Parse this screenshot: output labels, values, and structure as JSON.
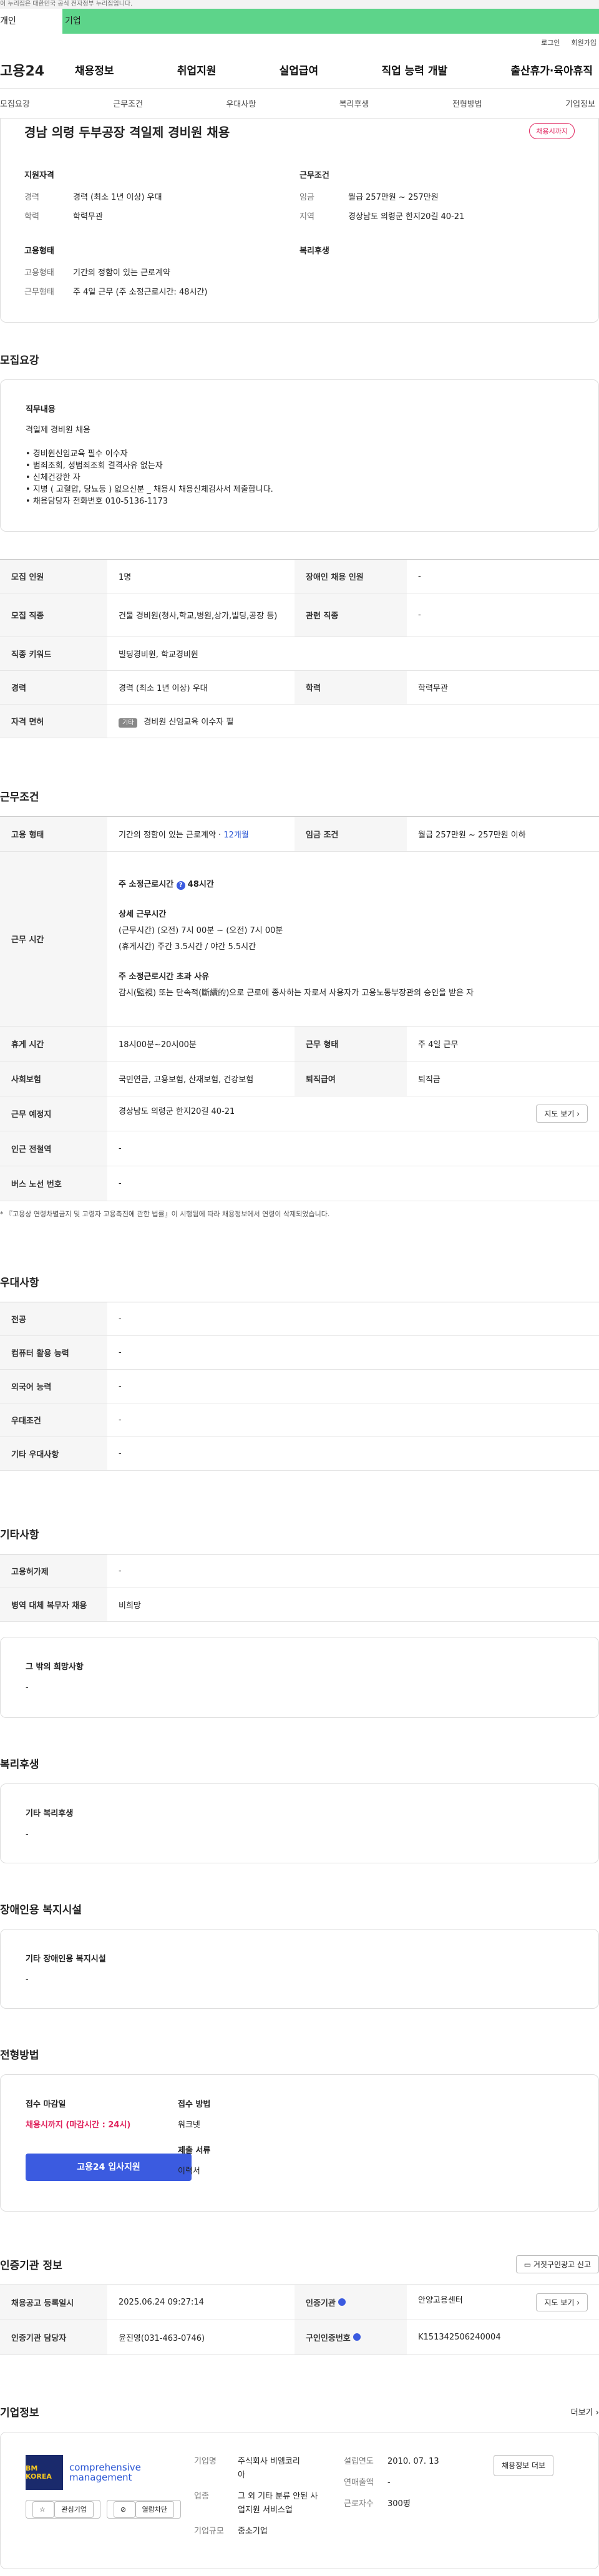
{
  "gov_banner": "이 누리집은 대한민국 공식 전자정부 누리집입니다.",
  "top_tabs": [
    "개인",
    "기업"
  ],
  "util_links": [
    "로그인",
    "회원가입"
  ],
  "logo": "고용24",
  "gnb": [
    "채용정보",
    "취업지원",
    "실업급여",
    "직업 능력 개발",
    "출산휴가·육아휴직"
  ],
  "anchor_nav": [
    "모집요강",
    "근무조건",
    "우대사항",
    "복리후생",
    "전형방법",
    "기업정보"
  ],
  "job": {
    "title": "경남 의령 두부공장 격일제 경비원 채용",
    "status_badge": "채용시까지",
    "qual_heading": "지원자격",
    "career_label": "경력",
    "career_value": "경력 (최소 1년 이상) 우대",
    "edu_label": "학력",
    "edu_value": "학력무관",
    "work_heading": "근무조건",
    "wage_label": "임금",
    "wage_value": "월급 257만원 ~ 257만원",
    "region_label": "지역",
    "region_value": "경상남도 의령군 한지20길 40-21",
    "emp_heading": "고용형태",
    "emp_label": "고용형태",
    "emp_value": "기간의 정함이 있는 근로계약",
    "worktype_label": "근무형태",
    "worktype_value": "주 4일 근무 (주 소정근로시간: 48시간)",
    "welfare_heading": "복리후생"
  },
  "recruit": {
    "heading": "모집요강",
    "duty_heading": "직무내용",
    "duty_lines": [
      "격일제 경비원 채용",
      "",
      "• 경비원신임교육 필수 이수자",
      "• 범죄조회, 성범죄조회 결격사유 없는자",
      "• 신체건강한 자",
      "• 지병 ( 고혈압, 당뇨등 ) 없으신분 _ 채용시 채용신체검사서 제출합니다.",
      "• 채용담당자 전화번호 010-5136-1173"
    ],
    "rows": {
      "count_label": "모집 인원",
      "count_value": "1명",
      "disabled_label": "장애인 채용 인원",
      "disabled_value": "-",
      "job_label": "모집 직종",
      "job_value": "건물 경비원(청사,학교,병원,상가,빌딩,공장 등)",
      "related_label": "관련 직종",
      "related_value": "-",
      "keyword_label": "직종 키워드",
      "keyword_value": "빌딩경비원, 학교경비원",
      "career_label": "경력",
      "career_value": "경력 (최소 1년 이상) 우대",
      "edu_label": "학력",
      "edu_value": "학력무관",
      "license_label": "자격 면허",
      "license_badge": "기타",
      "license_value": "경비원 신임교육 이수자 필"
    }
  },
  "work": {
    "heading": "근무조건",
    "emp_label": "고용 형태",
    "emp_value": "기간의 정함이 있는 근로계약 · ",
    "emp_period": "12개월",
    "wage_label": "임금 조건",
    "wage_value": "월급 257만원 ~ 257만원 이하",
    "hours_label": "근무 시간",
    "hours_week": "주 소정근로시간 ",
    "hours_week_value": "48시간",
    "hours_detail_title": "상세 근무시간",
    "hours_detail_1": "(근무시간) (오전) 7시 00분 ~ (오전) 7시 00분",
    "hours_detail_2": "(휴게시간) 주간 3.5시간 / 야간 5.5시간",
    "hours_over_title": "주 소정근로시간 초과 사유",
    "hours_over_text": "감시(監視) 또는 단속적(斷續的)으로 근로에 종사하는 자로서 사용자가 고용노동부장관의 승인을 받은 자",
    "break_label": "휴게 시간",
    "break_value": "18시00분~20시00분",
    "worktype_label": "근무 형태",
    "worktype_value": "주 4일 근무",
    "insurance_label": "사회보험",
    "insurance_value": "국민연금, 고용보험, 산재보험, 건강보험",
    "severance_label": "퇴직급여",
    "severance_value": "퇴직금",
    "location_label": "근무 예정지",
    "location_value": "경상남도 의령군 한지20길 40-21",
    "map_button": "지도 보기",
    "station_label": "인근 전철역",
    "station_value": "-",
    "bus_label": "버스 노선 번호",
    "bus_value": "-",
    "note": "* 『고용상 연령차별금지 및 고령자 고용촉진에 관한 법률』이 시행됨에 따라 채용정보에서 연령이 삭제되었습니다."
  },
  "prefer": {
    "heading": "우대사항",
    "rows": [
      {
        "label": "전공",
        "value": "-"
      },
      {
        "label": "컴퓨터 활용 능력",
        "value": "-"
      },
      {
        "label": "외국어 능력",
        "value": "-"
      },
      {
        "label": "우대조건",
        "value": "-"
      },
      {
        "label": "기타 우대사항",
        "value": "-"
      }
    ]
  },
  "etc": {
    "heading": "기타사항",
    "rows": [
      {
        "label": "고용허가제",
        "value": "-"
      },
      {
        "label": "병역 대체 복무자 채용",
        "value": "비희망"
      }
    ],
    "other_title": "그 밖의 희망사항",
    "other_value": "-"
  },
  "welfare": {
    "heading": "복리후생",
    "title": "기타 복리후생",
    "value": "-"
  },
  "disability": {
    "heading": "장애인용 복지시설",
    "title": "기타 장애인용 복지시설",
    "value": "-"
  },
  "process": {
    "heading": "전형방법",
    "deadline_label": "접수 마감일",
    "deadline_value": "채용시까지 (마감시간 : 24시)",
    "method_label": "접수 방법",
    "method_value": "워크넷",
    "docs_label": "제출 서류",
    "docs_value": "이력서",
    "apply_button": "고용24 입사지원"
  },
  "cert": {
    "heading": "인증기관 정보",
    "report_button": "거짓구인광고 신고",
    "reg_label": "채용공고 등록일시",
    "reg_value": "2025.06.24 09:27:14",
    "agency_label": "인증기관",
    "agency_value": "안양고용센터",
    "map_button": "지도 보기",
    "manager_label": "인증기관 담당자",
    "manager_value": "윤진영(031-463-0746)",
    "no_label": "구인인증번호",
    "no_value": "K151342506240004"
  },
  "company": {
    "heading": "기업정보",
    "more": "더보기",
    "logo_text": "BM KOREA",
    "logo_caption": "comprehensive management",
    "follow_button": "관심기업",
    "block_button": "열람차단",
    "name_label": "기업명",
    "name_value": "주식회사 비엠코리아",
    "industry_label": "업종",
    "industry_value": "그 외 기타 분류 안된 사업지원 서비스업",
    "size_label": "기업규모",
    "size_value": "중소기업",
    "founded_label": "설립연도",
    "founded_value": "2010. 07. 13",
    "sales_label": "연매출액",
    "sales_value": "-",
    "staff_label": "근로자수",
    "staff_value": "300명",
    "jobs_button": "채용정보 더보"
  }
}
